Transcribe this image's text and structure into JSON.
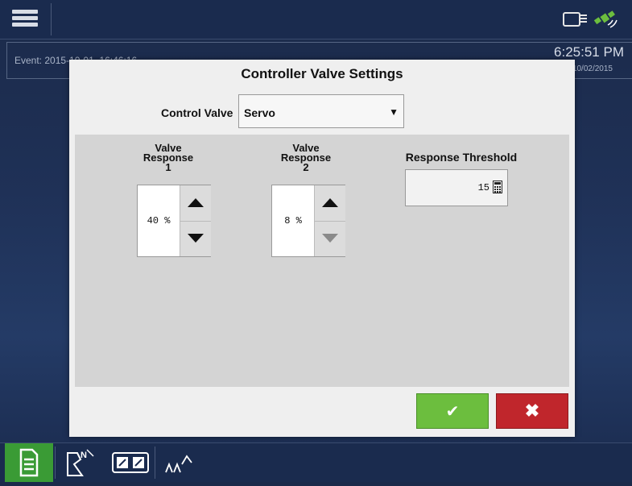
{
  "topbar": {
    "menu_icon": "hamburger-menu-icon",
    "status_icons": [
      "display-icon",
      "satellite-gps-icon"
    ]
  },
  "event": {
    "label": "Event: 2015-10-01_16:46:16",
    "clock": "6:25:51 PM",
    "date": "10/02/2015"
  },
  "dialog": {
    "title": "Controller Valve Settings",
    "control_valve_label": "Control Valve",
    "control_valve_value": "Servo",
    "valve_response_1": {
      "label_line1": "Valve",
      "label_line2": "Response",
      "label_line3": "1",
      "value": "40 %"
    },
    "valve_response_2": {
      "label_line1": "Valve",
      "label_line2": "Response",
      "label_line3": "2",
      "value": "8 %"
    },
    "response_threshold": {
      "label": "Response Threshold",
      "value": "15"
    },
    "ok_glyph": "✔",
    "cancel_glyph": "✖",
    "colors": {
      "ok": "#6cbe3e",
      "cancel": "#c0262c"
    }
  },
  "bottombar": {
    "tabs": [
      "home-icon",
      "field-map-icon",
      "split-view-icon",
      "planting-icon"
    ]
  }
}
